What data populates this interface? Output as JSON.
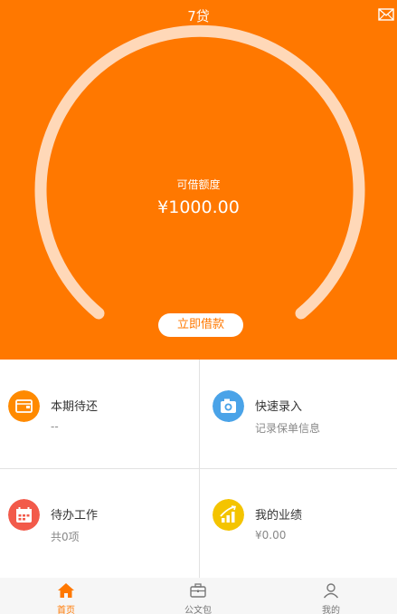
{
  "header": {
    "title": "7贷",
    "mail_icon": "mail-icon"
  },
  "credit": {
    "label": "可借额度",
    "value": "¥1000.00",
    "button": "立即借款"
  },
  "cards": [
    {
      "title": "本期待还",
      "subtitle": "--",
      "icon": "wallet-icon",
      "color": "#ff8a00"
    },
    {
      "title": "快速录入",
      "subtitle": "记录保单信息",
      "icon": "camera-icon",
      "color": "#4aa3e8"
    },
    {
      "title": "待办工作",
      "subtitle": "共0项",
      "icon": "calendar-icon",
      "color": "#f25a4a"
    },
    {
      "title": "我的业绩",
      "subtitle": "¥0.00",
      "icon": "chart-icon",
      "color": "#f4c400"
    }
  ],
  "tabs": [
    {
      "label": "首页",
      "icon": "home-icon",
      "active": true
    },
    {
      "label": "公文包",
      "icon": "briefcase-icon",
      "active": false
    },
    {
      "label": "我的",
      "icon": "person-icon",
      "active": false
    }
  ],
  "colors": {
    "brand": "#ff7800",
    "arc": "#ffd8b8"
  }
}
